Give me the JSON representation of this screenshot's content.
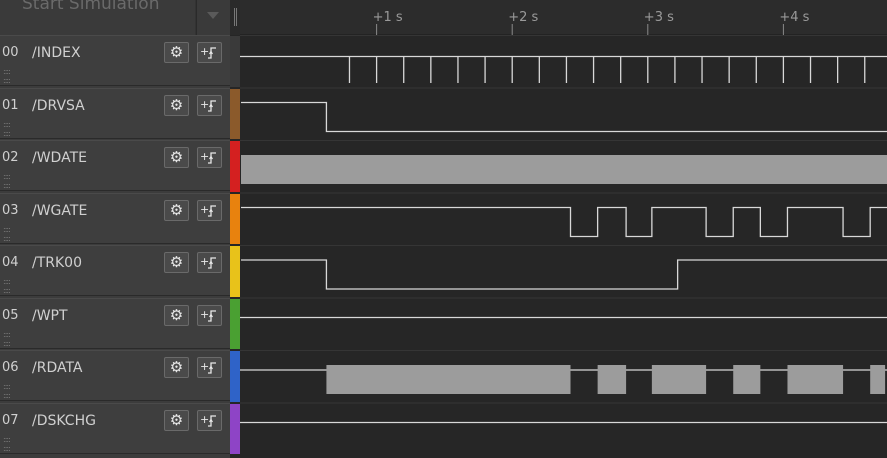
{
  "toolbar": {
    "start_simulation_label": "Start Simulation"
  },
  "timeline": {
    "ticks": [
      {
        "label": "+1 s",
        "t": 1
      },
      {
        "label": "+2 s",
        "t": 2
      },
      {
        "label": "+3 s",
        "t": 3
      },
      {
        "label": "+4 s",
        "t": 4
      }
    ]
  },
  "icons": {
    "gear": "gear-icon",
    "trigger": "trigger-icon",
    "grip": "drag-handle-icon",
    "dropdown": "chevron-down-icon"
  },
  "channels": [
    {
      "num": "00",
      "name": "/INDEX",
      "color": "#3a3a3a"
    },
    {
      "num": "01",
      "name": "/DRVSA",
      "color": "#8b5a2b"
    },
    {
      "num": "02",
      "name": "/WDATE",
      "color": "#d42020"
    },
    {
      "num": "03",
      "name": "/WGATE",
      "color": "#e8820e"
    },
    {
      "num": "04",
      "name": "/TRK00",
      "color": "#e8c21a"
    },
    {
      "num": "05",
      "name": "/WPT",
      "color": "#4aa032"
    },
    {
      "num": "06",
      "name": "/RDATA",
      "color": "#2f63c8"
    },
    {
      "num": "07",
      "name": "/DSKCHG",
      "color": "#8e44c6"
    }
  ],
  "waveforms": {
    "t_start": 0.0,
    "t_end": 4.75,
    "index_pulses": [
      0.8,
      1.0,
      1.2,
      1.4,
      1.6,
      1.8,
      2.0,
      2.2,
      2.4,
      2.6,
      2.8,
      3.0,
      3.2,
      3.4,
      3.6,
      3.8,
      4.0,
      4.2,
      4.4,
      4.6
    ],
    "drvsa_steps": [
      {
        "t": 0.0,
        "level": 1
      },
      {
        "t": 0.63,
        "level": 0
      }
    ],
    "wdate_state": "filled",
    "wgate_steps": [
      {
        "t": 0.0,
        "level": 1
      },
      {
        "t": 2.43,
        "level": 0
      },
      {
        "t": 2.63,
        "level": 1
      },
      {
        "t": 2.84,
        "level": 0
      },
      {
        "t": 3.03,
        "level": 1
      },
      {
        "t": 3.43,
        "level": 0
      },
      {
        "t": 3.63,
        "level": 1
      },
      {
        "t": 3.83,
        "level": 0
      },
      {
        "t": 4.03,
        "level": 1
      },
      {
        "t": 4.44,
        "level": 0
      },
      {
        "t": 4.64,
        "level": 1
      }
    ],
    "trk00_steps": [
      {
        "t": 0.0,
        "level": 1
      },
      {
        "t": 0.63,
        "level": 0
      },
      {
        "t": 3.22,
        "level": 1
      }
    ],
    "rdata_bursts": [
      [
        0.63,
        2.43
      ],
      [
        2.63,
        2.84
      ],
      [
        3.03,
        3.43
      ],
      [
        3.63,
        3.83
      ],
      [
        4.03,
        4.44
      ],
      [
        4.64,
        4.75
      ]
    ]
  }
}
